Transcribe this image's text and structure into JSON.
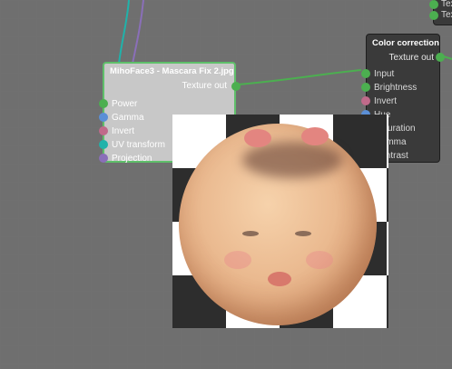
{
  "colors": {
    "background": "#6f6f6f",
    "wire_green": "#4caf50",
    "wire_cyan": "#20b2aa",
    "wire_purple": "#8a6fb8",
    "pin_green": "#4caf50",
    "pin_blue": "#5b8fd6",
    "pin_pink": "#c06a8a",
    "pin_cyan": "#20b2aa",
    "pin_purple": "#8a6fb8"
  },
  "top_node": {
    "ports": [
      "Tex",
      "Tex"
    ]
  },
  "texture_node": {
    "title": "MihoFace3 - Mascara Fix 2.jpg",
    "output": "Texture out",
    "inputs": [
      {
        "label": "Power",
        "icon": "green-pin-icon"
      },
      {
        "label": "Gamma",
        "icon": "blue-pin-icon"
      },
      {
        "label": "Invert",
        "icon": "pink-pin-icon"
      },
      {
        "label": "UV transform",
        "icon": "cyan-pin-icon"
      },
      {
        "label": "Projection",
        "icon": "purple-pin-icon"
      }
    ]
  },
  "color_node": {
    "title": "Color correction",
    "output": "Texture out",
    "inputs": [
      {
        "label": "Input",
        "icon": "green-pin-icon"
      },
      {
        "label": "Brightness",
        "icon": "green-pin-icon"
      },
      {
        "label": "Invert",
        "icon": "pink-pin-icon"
      },
      {
        "label": "Hue",
        "icon": "blue-pin-icon"
      },
      {
        "label": "Saturation",
        "icon": "blue-pin-icon"
      },
      {
        "label": "Gamma",
        "icon": "blue-pin-icon"
      },
      {
        "label": "Contrast",
        "icon": "blue-pin-icon"
      }
    ]
  },
  "preview": {
    "content": "face-texture-preview"
  }
}
